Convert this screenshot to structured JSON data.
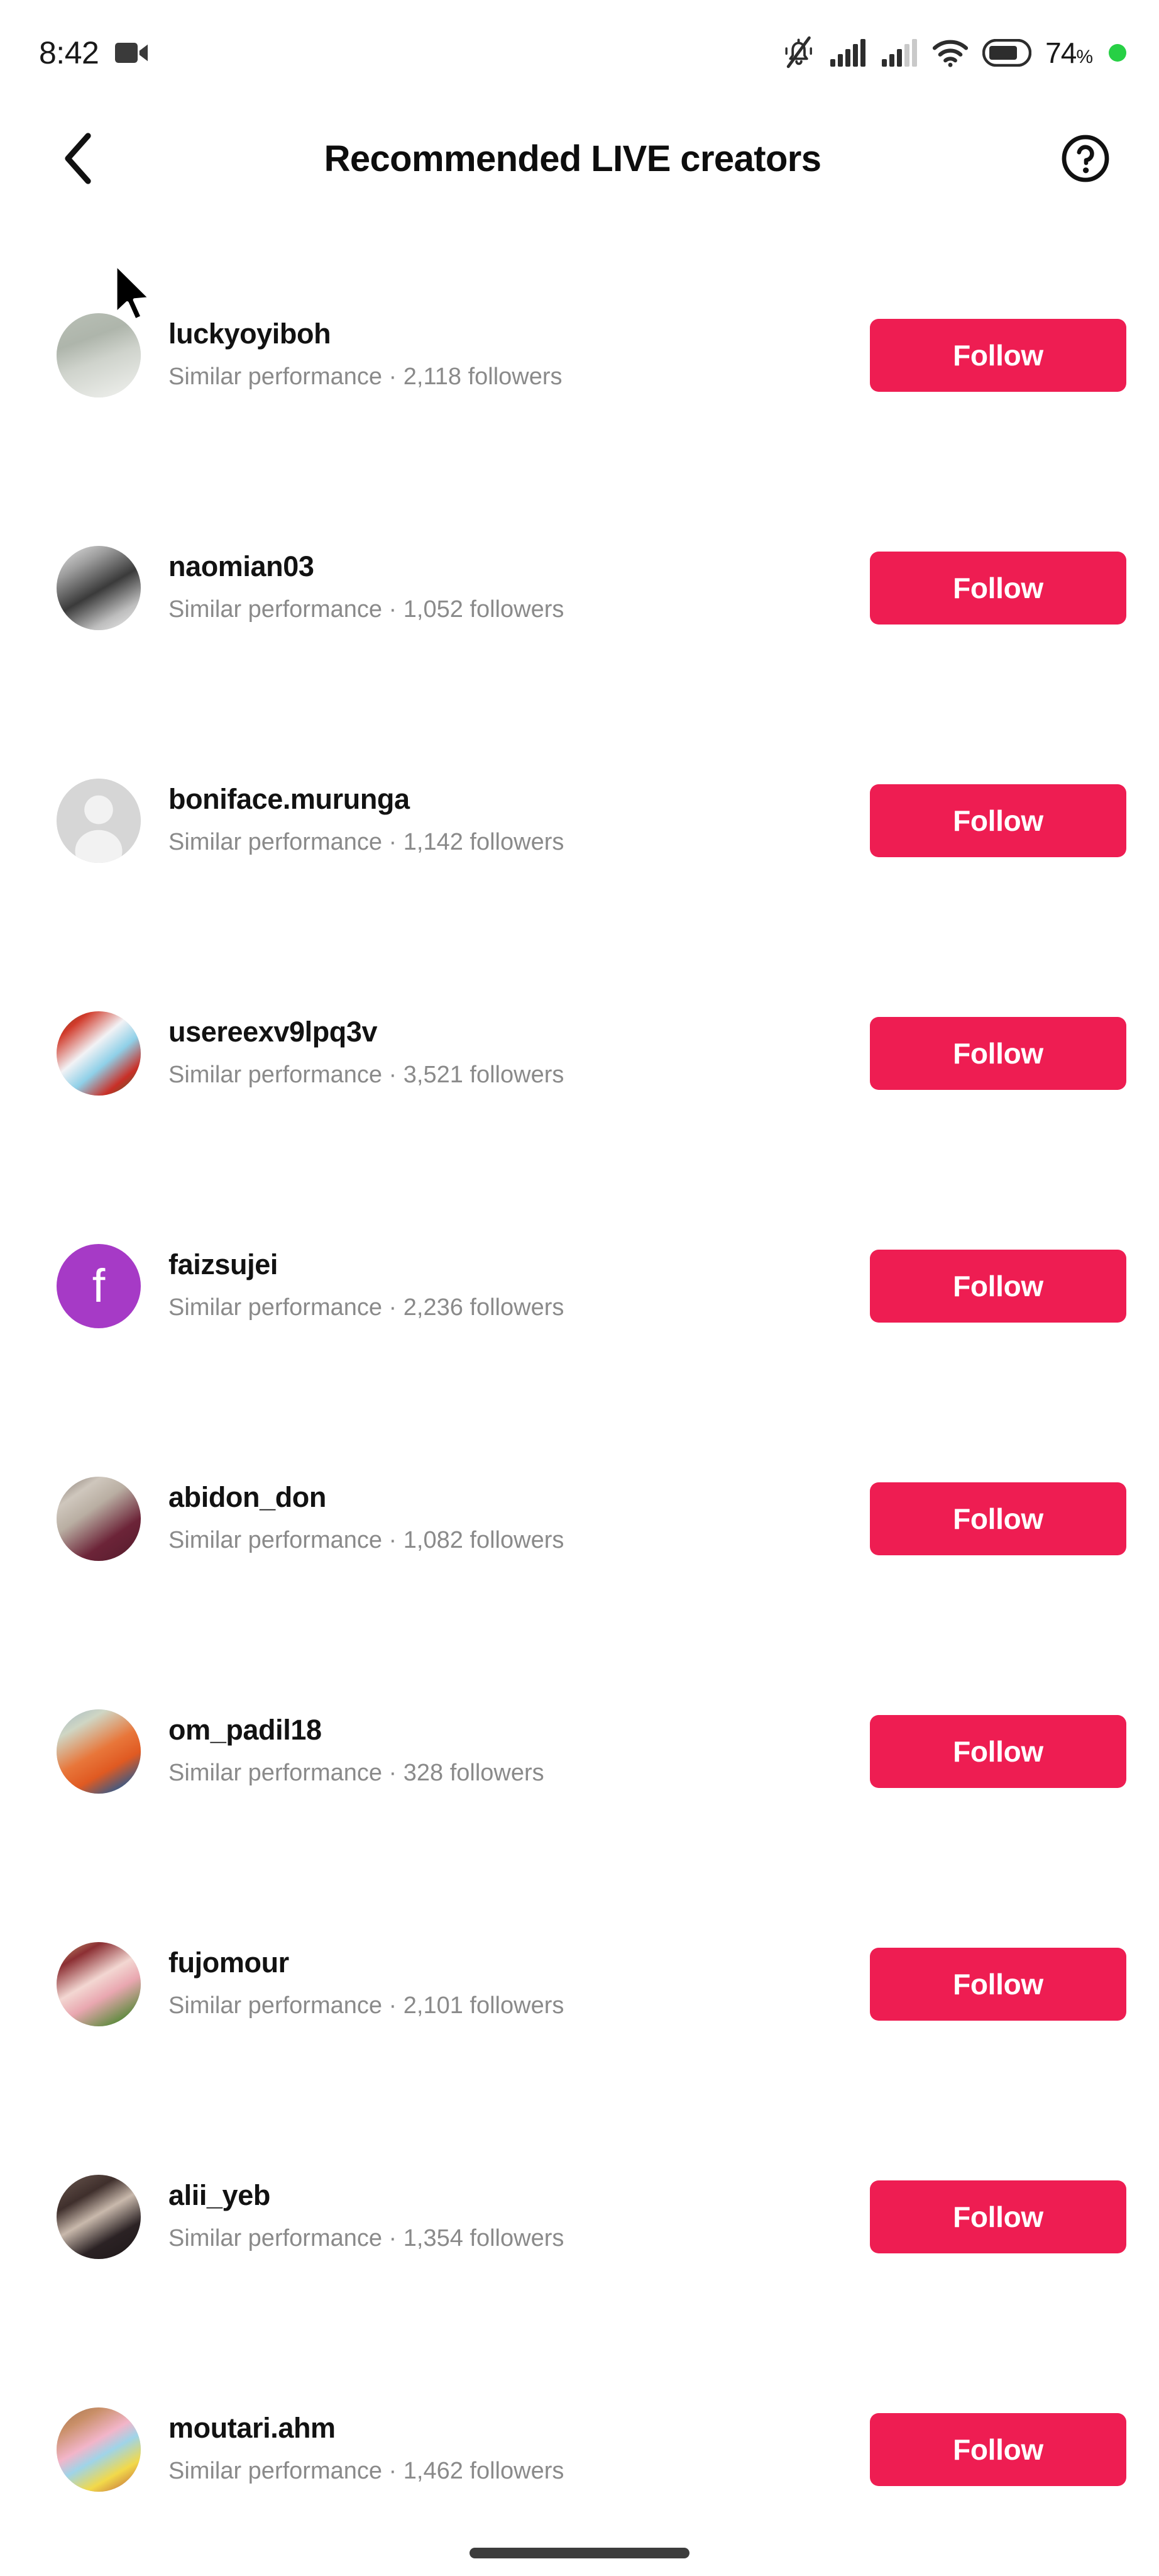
{
  "status_bar": {
    "time": "8:42",
    "recording_icon": "video-camera-icon",
    "mute_icon": "bell-muted-icon",
    "signal_icon_1": "cellular-signal-icon",
    "signal_icon_2": "cellular-signal-icon",
    "wifi_icon": "wifi-icon",
    "battery_icon": "battery-icon",
    "battery_percent": "74",
    "percent_sign": "%",
    "status_dot": "green-status-dot"
  },
  "header": {
    "back_icon": "chevron-left-icon",
    "title": "Recommended LIVE creators",
    "help_icon": "question-circle-icon"
  },
  "colors": {
    "follow_button": "#ee1d52",
    "follow_text": "#ffffff",
    "username": "#121212",
    "meta_text": "#8a8a8a",
    "background": "#ffffff",
    "status_dot": "#27d045",
    "gesture_bar": "#3c3c3c"
  },
  "creators": [
    {
      "username": "luckyoyiboh",
      "meta": "Similar performance · 2,118 followers",
      "follow_label": "Follow",
      "avatar_type": "photo",
      "avatar_desc": "man-in-white-shirt-photo",
      "avatar_css": "linear-gradient(160deg,#b9c0b6 0%,#aeb5ab 32%,#cfd3cc 55%,#f1f2ef 100%)"
    },
    {
      "username": "naomian03",
      "meta": "Similar performance · 1,052 followers",
      "follow_label": "Follow",
      "avatar_type": "photo",
      "avatar_desc": "grayscale-girl-portrait-photo",
      "avatar_css": "linear-gradient(150deg,#e8e8e8 0%,#9d9d9d 25%,#3a3a3a 52%,#bdbdbd 78%,#f3f3f3 100%)"
    },
    {
      "username": "boniface.murunga",
      "meta": "Similar performance · 1,142 followers",
      "follow_label": "Follow",
      "avatar_type": "placeholder",
      "avatar_desc": "default-person-placeholder",
      "avatar_css": "#d6d6d6"
    },
    {
      "username": "usereexv9lpq3v",
      "meta": "Similar performance · 3,521 followers",
      "follow_label": "Follow",
      "avatar_type": "photo",
      "avatar_desc": "white-doves-with-red-flowers-photo",
      "avatar_css": "linear-gradient(140deg,#6d4b2a 0%,#d13a2a 18%,#f2f2f5 42%,#8fd0e8 60%,#c92f27 80%,#2f6b2a 100%)"
    },
    {
      "username": "faizsujei",
      "meta": "Similar performance · 2,236 followers",
      "follow_label": "Follow",
      "avatar_type": "letter",
      "avatar_letter": "f",
      "avatar_desc": "purple-initial-avatar",
      "avatar_css": "#a63ac6"
    },
    {
      "username": "abidon_don",
      "meta": "Similar performance · 1,082 followers",
      "follow_label": "Follow",
      "avatar_type": "photo",
      "avatar_desc": "dark-maroon-scene-photo",
      "avatar_css": "linear-gradient(145deg,#7d7068 0%,#cfc7bd 22%,#b9aea2 40%,#6c2438 70%,#531b2c 100%)"
    },
    {
      "username": "om_padil18",
      "meta": "Similar performance · 328 followers",
      "follow_label": "Follow",
      "avatar_type": "photo",
      "avatar_desc": "child-in-orange-outdoor-photo",
      "avatar_css": "linear-gradient(150deg,#9fb6c4 0%,#cfd6c4 22%,#e8763a 50%,#e05a22 68%,#3a5a86 88%,#2c4a6b 100%)"
    },
    {
      "username": "fujomour",
      "meta": "Similar performance · 2,101 followers",
      "follow_label": "Follow",
      "avatar_type": "photo",
      "avatar_desc": "person-in-pink-on-grass-photo",
      "avatar_css": "linear-gradient(150deg,#c7a277 0%,#8c2f33 20%,#f3d7d2 45%,#e9a7b0 62%,#5b8a3c 88%,#3f6b2a 100%)"
    },
    {
      "username": "alii_yeb",
      "meta": "Similar performance · 1,354 followers",
      "follow_label": "Follow",
      "avatar_type": "photo",
      "avatar_desc": "man-in-dark-shirt-photo",
      "avatar_css": "linear-gradient(150deg,#6d5a52 0%,#3f2f2c 28%,#c9b9ac 48%,#2b2224 72%,#1d1718 100%)"
    },
    {
      "username": "moutari.ahm",
      "meta": "Similar performance · 1,462 followers",
      "follow_label": "Follow",
      "avatar_type": "photo",
      "avatar_desc": "person-in-pink-and-yellow-by-brick-wall-photo",
      "avatar_css": "linear-gradient(150deg,#a3714e 0%,#c98f68 20%,#f2b5c9 42%,#9fd4e8 56%,#f2d94a 76%,#b8523a 100%)"
    }
  ],
  "cursor": {
    "icon": "mouse-pointer-cursor"
  },
  "gesture_bar": {
    "icon": "home-gesture-bar"
  }
}
